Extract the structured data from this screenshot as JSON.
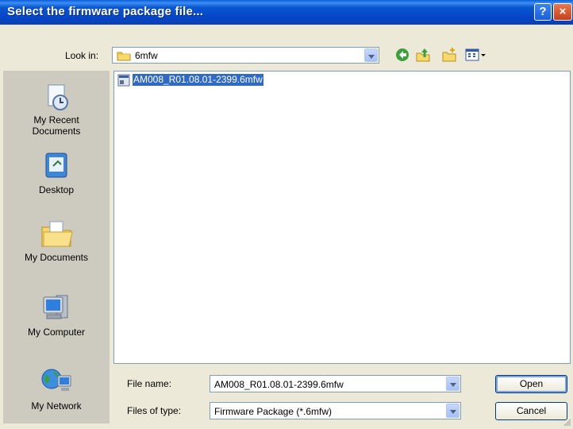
{
  "window": {
    "title": "Select the firmware package file..."
  },
  "titlebar": {
    "help_glyph": "?",
    "close_glyph": "×"
  },
  "look_in": {
    "label": "Look in:",
    "value": "6mfw"
  },
  "toolbar": {
    "icons": [
      "back-icon",
      "up-folder-icon",
      "new-folder-icon",
      "view-menu-icon"
    ]
  },
  "places": [
    {
      "label_line1": "My Recent",
      "label_line2": "Documents",
      "icon": "recent-documents-icon"
    },
    {
      "label_line1": "Desktop",
      "label_line2": "",
      "icon": "desktop-icon"
    },
    {
      "label_line1": "My Documents",
      "label_line2": "",
      "icon": "my-documents-icon"
    },
    {
      "label_line1": "My Computer",
      "label_line2": "",
      "icon": "my-computer-icon"
    },
    {
      "label_line1": "My Network",
      "label_line2": "",
      "icon": "my-network-icon"
    }
  ],
  "files": [
    {
      "name": "AM008_R01.08.01-2399.6mfw",
      "selected": true
    }
  ],
  "file_name": {
    "label": "File name:",
    "value": "AM008_R01.08.01-2399.6mfw"
  },
  "file_type": {
    "label": "Files of type:",
    "value": "Firmware Package (*.6mfw)"
  },
  "buttons": {
    "open": "Open",
    "cancel": "Cancel"
  },
  "colors": {
    "titlebar": "#0a56d0",
    "selection": "#316ac5",
    "dialog_bg": "#ece9d8",
    "places_bg": "#cdcbc0"
  }
}
